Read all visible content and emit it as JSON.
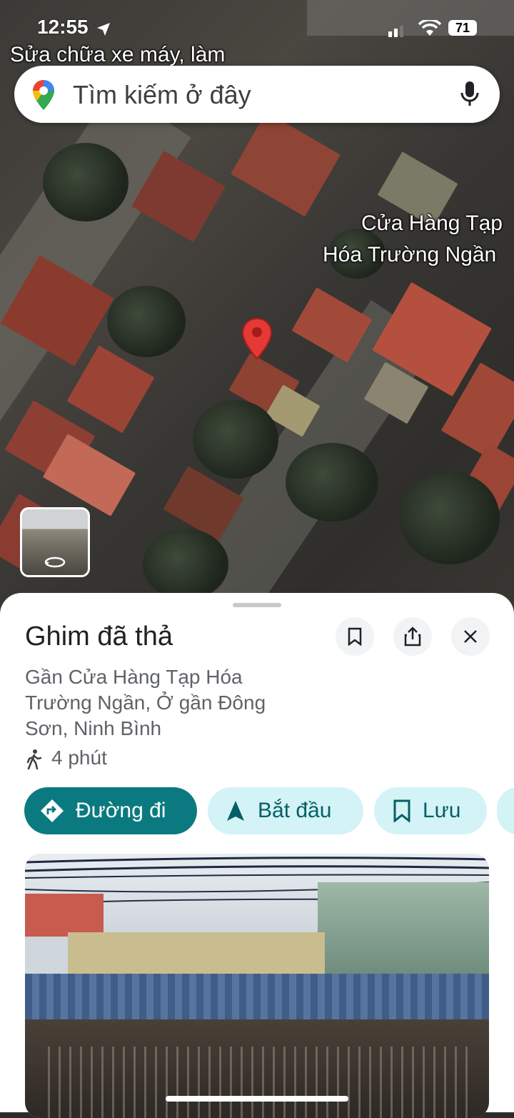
{
  "status_bar": {
    "time": "12:55",
    "battery": "71"
  },
  "map": {
    "top_label": "Sửa chữa xe máy, làm",
    "poi_label_line1": "Cửa Hàng Tạp",
    "poi_label_line2": "Hóa Trường Ngần"
  },
  "search": {
    "placeholder": "Tìm kiếm ở đây"
  },
  "sheet": {
    "title": "Ghim đã thả",
    "address": "Gần Cửa Hàng Tạp Hóa Trường Ngần, Ở gần Đông Sơn, Ninh Bình",
    "walk_time": "4 phút",
    "actions": {
      "directions": "Đường đi",
      "start": "Bắt đầu",
      "save": "Lưu"
    }
  },
  "colors": {
    "accent": "#0b7a80",
    "chip_bg": "#d3f3f7",
    "pin": "#e53935"
  }
}
